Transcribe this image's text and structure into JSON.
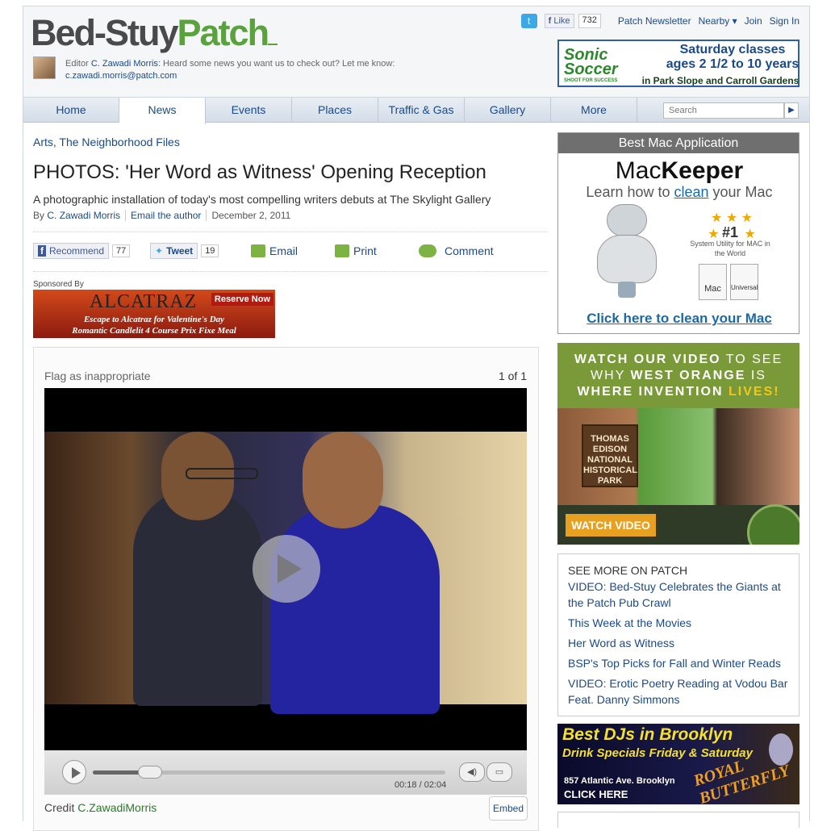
{
  "header": {
    "logo_part1": "Bed-Stuy",
    "logo_part2": "Patch",
    "editor_prefix": "Editor",
    "editor_name": "C. Zawadi Morris",
    "editor_msg": ": Heard some news you want us to check out? Let me know:",
    "editor_email": "c.zawadi.morris@patch.com",
    "fb_like": "Like",
    "fb_count": "732",
    "twitter_icon": "twitter-icon",
    "links": [
      "Patch Newsletter",
      "Nearby ▾",
      "Join",
      "Sign In"
    ]
  },
  "ad_soccer": {
    "brand": "Sonic Soccer",
    "tagline": "SHOOT FOR SUCCESS",
    "line1": "Saturday classes",
    "line2": "ages 2 1/2 to 10 years",
    "line3": "in Park Slope and Carroll Gardens"
  },
  "nav": {
    "items": [
      "Home",
      "News",
      "Events",
      "Places",
      "Traffic & Gas",
      "Gallery",
      "More"
    ],
    "active": "News",
    "search_placeholder": "Search",
    "search_button": "▶"
  },
  "article": {
    "categories": "Arts, The Neighborhood Files",
    "title": "PHOTOS: 'Her Word as Witness' Opening Reception",
    "subtitle": "A photographic installation of today's most compelling writers debuts at The Skylight Gallery",
    "by_prefix": "By",
    "author": "C. Zawadi Morris",
    "email_author": "Email the author",
    "date": "December 2, 2011"
  },
  "share": {
    "recommend": "Recommend",
    "recommend_count": "77",
    "tweet": "Tweet",
    "tweet_count": "19",
    "email": "Email",
    "print": "Print",
    "comment": "Comment"
  },
  "sponsor": {
    "label": "Sponsored By",
    "name": "ALCATRAZ",
    "cta": "Reserve Now",
    "line1": "Escape to Alcatraz for Valentine's Day",
    "line2": "Romantic Candlelit 4 Course Prix Fixe Meal"
  },
  "gallery": {
    "flag": "Flag as inappropriate",
    "counter": "1 of 1",
    "time": "00:18 / 02:04",
    "progress": 0.14,
    "credit_label": "Credit",
    "credit_name": "C.ZawadiMorris",
    "embed": "Embed"
  },
  "ad_mac": {
    "header": "Best Mac Application",
    "brand_light": "Mac",
    "brand_bold": "Keeper",
    "learn1": "Learn how to ",
    "learn_link": "clean",
    "learn2": " your Mac",
    "rank": "#1",
    "rank_desc": "System Utility for MAC in the World",
    "badge1": "Mac",
    "badge2": "Universal",
    "cta": "Click here to clean your Mac"
  },
  "ad_west_orange": {
    "line1a": "WATCH OUR ",
    "line1b": "VIDEO",
    "line1c": " TO SEE",
    "line2a": "WHY ",
    "line2b": "WEST ORANGE",
    "line2c": " IS",
    "line3a": "WHERE INVENTION ",
    "line3b": "LIVES!",
    "sign": "THOMAS EDISON NATIONAL HISTORICAL PARK",
    "cta": "WATCH VIDEO"
  },
  "see_more": {
    "heading": "SEE MORE ON PATCH",
    "links": [
      "VIDEO: Bed-Stuy Celebrates the Giants at the Patch Pub Crawl",
      "This Week at the Movies",
      "Her Word as Witness",
      "BSP's Top Picks for Fall and Winter Reads",
      "VIDEO: Erotic Poetry Reading at Vodou Bar Feat. Danny Simmons"
    ]
  },
  "ad_dj": {
    "line1": "Best DJs in Brooklyn",
    "line2": "Drink Specials Friday & Saturday",
    "address": "857 Atlantic Ave. Brooklyn",
    "cta": "CLICK HERE",
    "venue": "ROYAL BUTTERFLY"
  }
}
